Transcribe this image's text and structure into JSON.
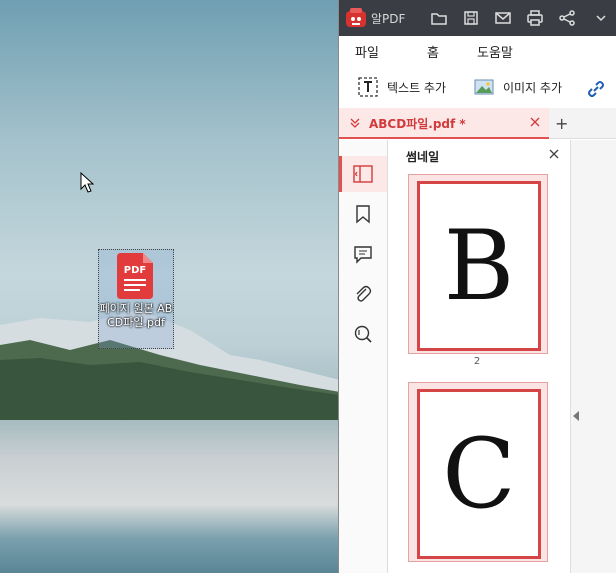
{
  "desktop": {
    "file_icon": {
      "badge": "PDF",
      "label": "페이지 원본 ABCD파일.pdf"
    }
  },
  "app": {
    "title": "알PDF",
    "menu": [
      "파일",
      "홈",
      "도움말"
    ],
    "toolbar": {
      "text_add": "텍스트 추가",
      "image_add": "이미지 추가"
    },
    "tab": {
      "label": "ABCD파일.pdf *"
    },
    "panel": {
      "title": "썸네일",
      "thumbnails": [
        {
          "letter": "B",
          "page": "2"
        },
        {
          "letter": "C",
          "page": ""
        }
      ]
    }
  },
  "colors": {
    "accent": "#e05252",
    "titlebar": "#3a3d44",
    "tab_bg": "#fde8e8"
  }
}
